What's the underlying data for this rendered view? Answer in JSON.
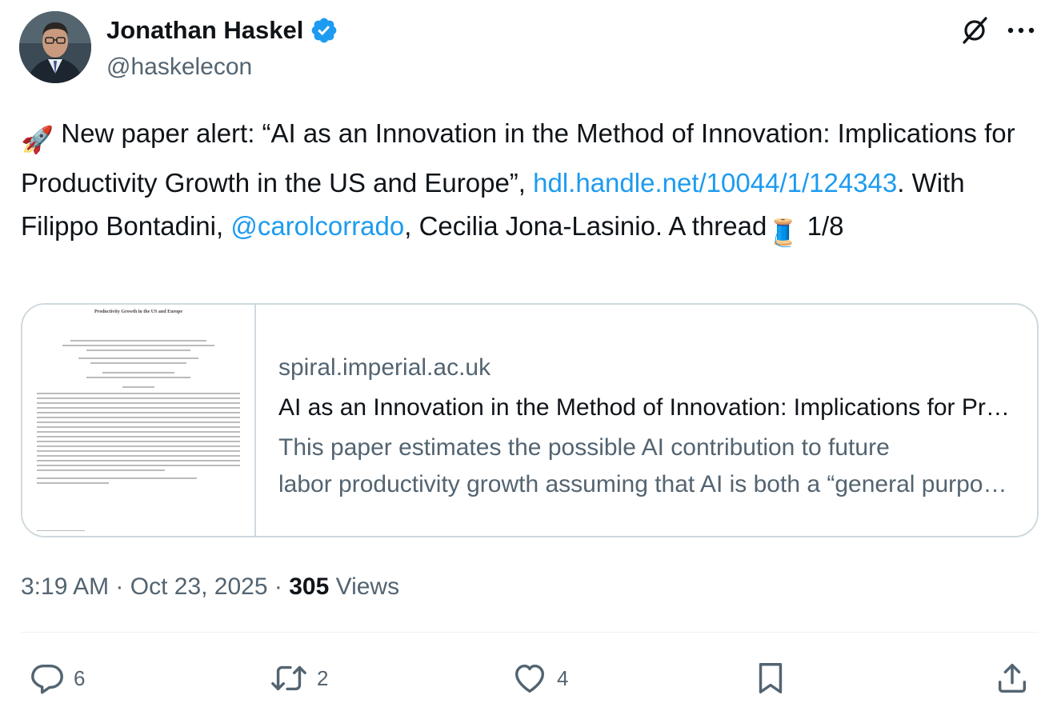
{
  "author": {
    "name": "Jonathan Haskel",
    "handle": "@haskelecon"
  },
  "tweet": {
    "rocket_emoji": "🚀",
    "text_1": " New paper alert: “AI as an Innovation in the Method of Innovation: Implications for Productivity Growth in the US and Europe”, ",
    "link_url": "hdl.handle.net/10044/1/124343",
    "text_2": ". With Filippo Bontadini, ",
    "mention": "@carolcorrado",
    "text_3": ", Cecilia Jona-Lasinio. A thread",
    "thread_emoji": "🧵",
    "text_4": " 1/8"
  },
  "card": {
    "thumb_heading": "Productivity Growth in the US and Europe",
    "domain": "spiral.imperial.ac.uk",
    "title": "AI as an Innovation in the Method of Innovation: Implications for Productivity Growth in the US and Europe",
    "desc_line1": "This paper estimates the possible AI contribution to future",
    "desc_line2": "labor productivity growth assuming that AI is both a “general purpose technology”"
  },
  "meta": {
    "time": "3:19 AM",
    "sep": " · ",
    "date": "Oct 23, 2025",
    "views_count": "305",
    "views_label": " Views"
  },
  "actions": {
    "replies": "6",
    "reposts": "2",
    "likes": "4"
  },
  "colors": {
    "link": "#1d9bf0",
    "secondary_text": "#536471",
    "border": "#cfd9de"
  }
}
